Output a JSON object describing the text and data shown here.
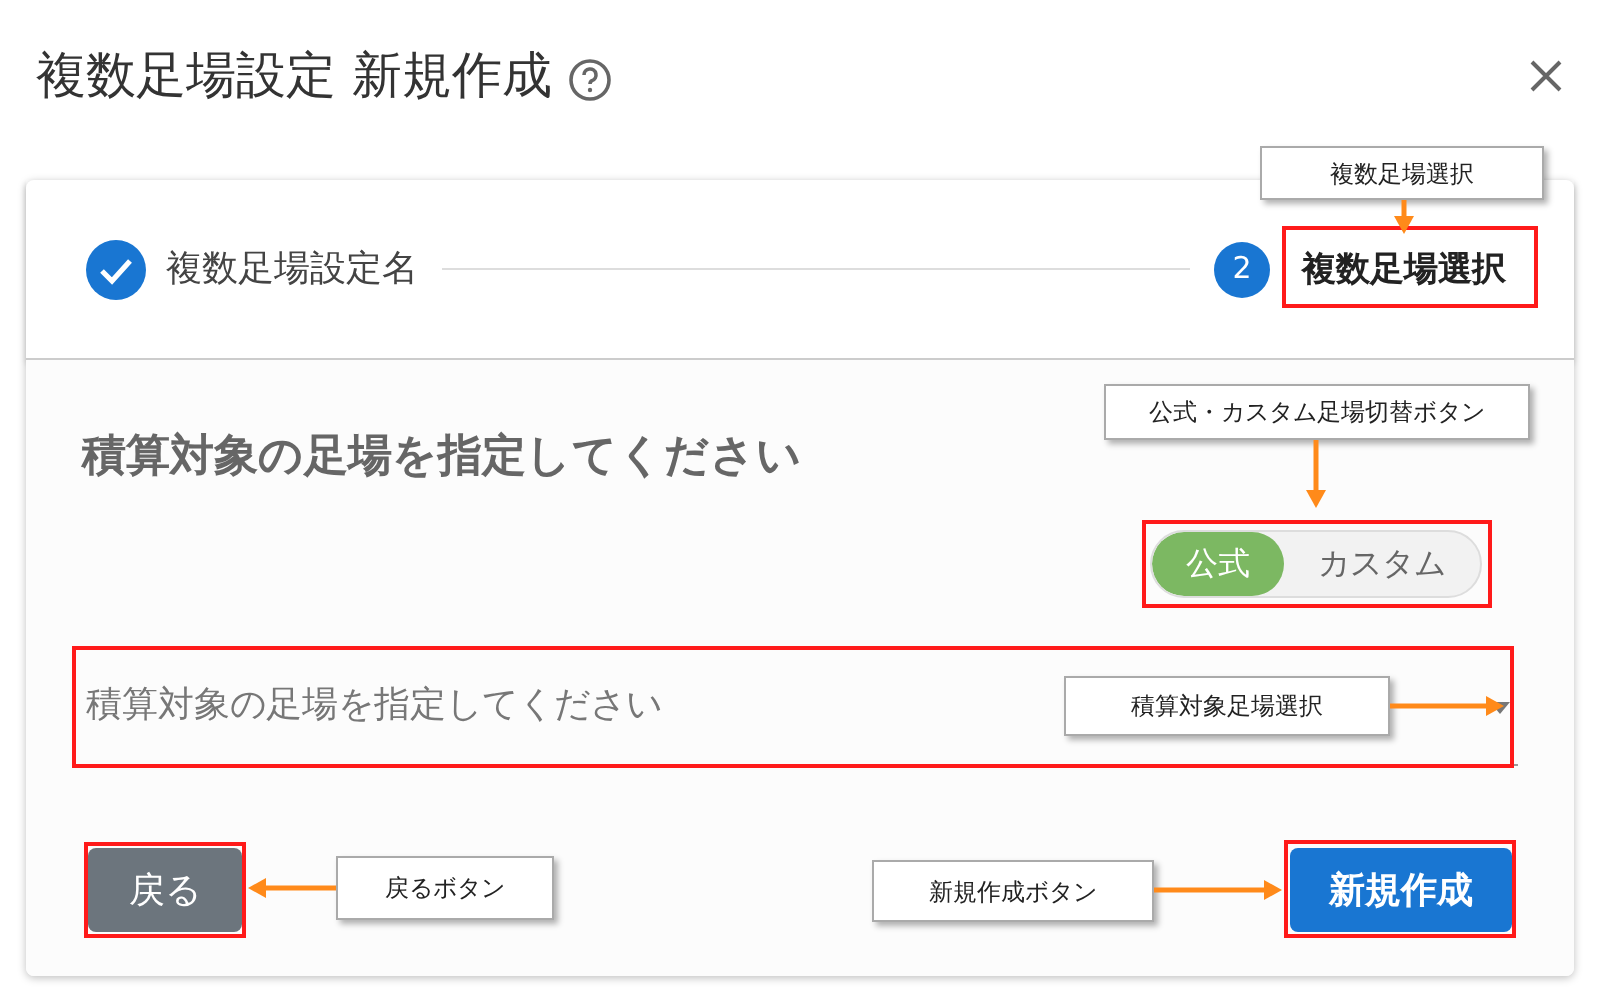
{
  "dialog": {
    "title": "複数足場設定 新規作成"
  },
  "steps": [
    {
      "label": "複数足場設定名",
      "completed": true,
      "active": false
    },
    {
      "label": "複数足場選択",
      "completed": false,
      "active": true,
      "number": "2"
    }
  ],
  "heading": "積算対象の足場を指定してください",
  "scaffold_type_toggle": [
    {
      "label": "公式",
      "selected": true
    },
    {
      "label": "カスタム",
      "selected": false
    }
  ],
  "scaffold_select": {
    "placeholder": "積算対象の足場を指定してください"
  },
  "buttons": [
    {
      "label": "戻る",
      "kind": "back"
    },
    {
      "label": "新規作成",
      "kind": "primary"
    }
  ],
  "annotations": [
    {
      "text": "複数足場選択"
    },
    {
      "text": "公式・カスタム足場切替ボタン"
    },
    {
      "text": "積算対象足場選択"
    },
    {
      "text": "戻るボタン"
    },
    {
      "text": "新規作成ボタン"
    }
  ]
}
